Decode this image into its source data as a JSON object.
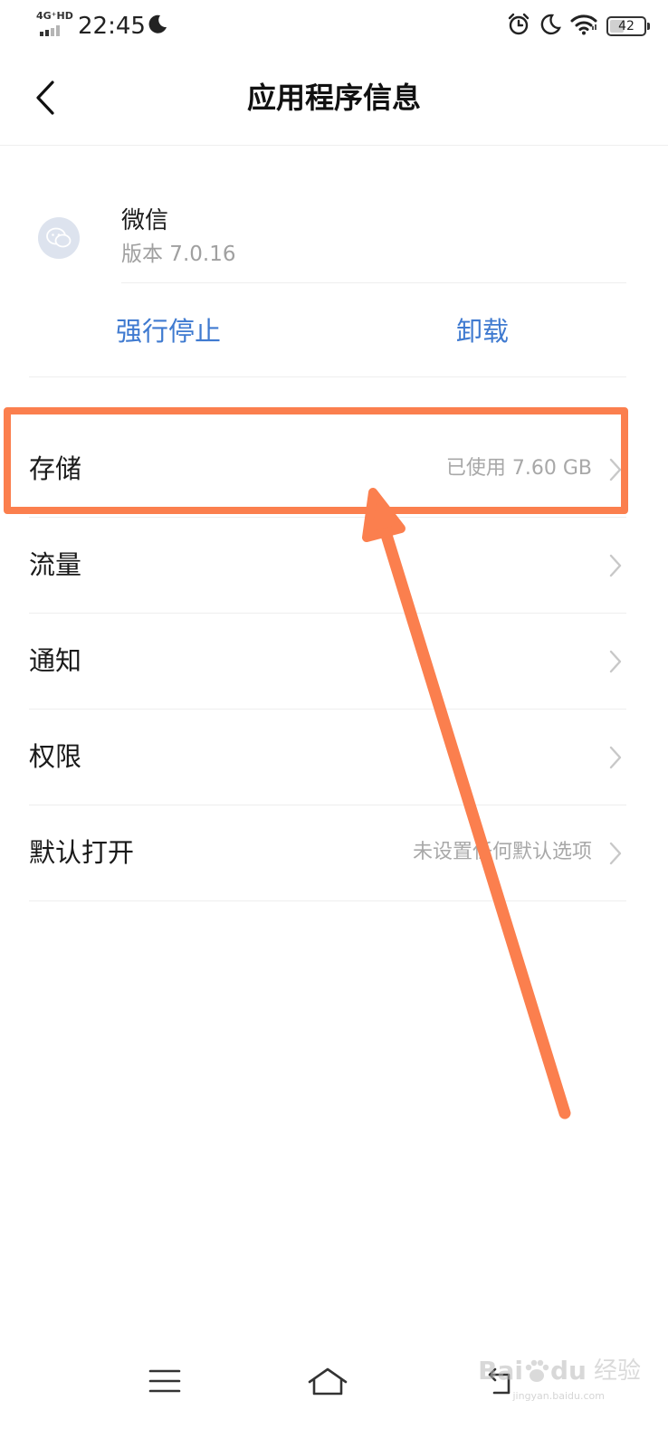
{
  "status_bar": {
    "network": "4G⁺HD",
    "time": "22:45",
    "battery": "42",
    "battery_level": 0.42,
    "icons": [
      "signal-icon",
      "moon-icon",
      "alarm-icon",
      "moon-icon",
      "wifi-icon",
      "battery-icon"
    ]
  },
  "header": {
    "title": "应用程序信息",
    "back_icon": "chevron-left-icon"
  },
  "app": {
    "name": "微信",
    "version": "版本 7.0.16",
    "icon": "wechat-icon"
  },
  "actions": {
    "force_stop": "强行停止",
    "uninstall": "卸载"
  },
  "settings": [
    {
      "label": "存储",
      "value": "已使用 7.60 GB"
    },
    {
      "label": "流量",
      "value": ""
    },
    {
      "label": "通知",
      "value": ""
    },
    {
      "label": "权限",
      "value": ""
    },
    {
      "label": "默认打开",
      "value": "未设置任何默认选项"
    }
  ],
  "annotation": {
    "color": "#fb7f4e",
    "highlighted_item": "存储"
  },
  "nav": {
    "icons": [
      "menu-icon",
      "home-icon",
      "back-icon"
    ]
  },
  "watermark": {
    "brand": "Bai",
    "brand_suffix": "du",
    "cn": "经验",
    "site": "jingyan.baidu.com"
  },
  "colors": {
    "accent": "#3f7ad0",
    "annotation": "#fb7f4e",
    "secondary_text": "#a0a0a0"
  }
}
